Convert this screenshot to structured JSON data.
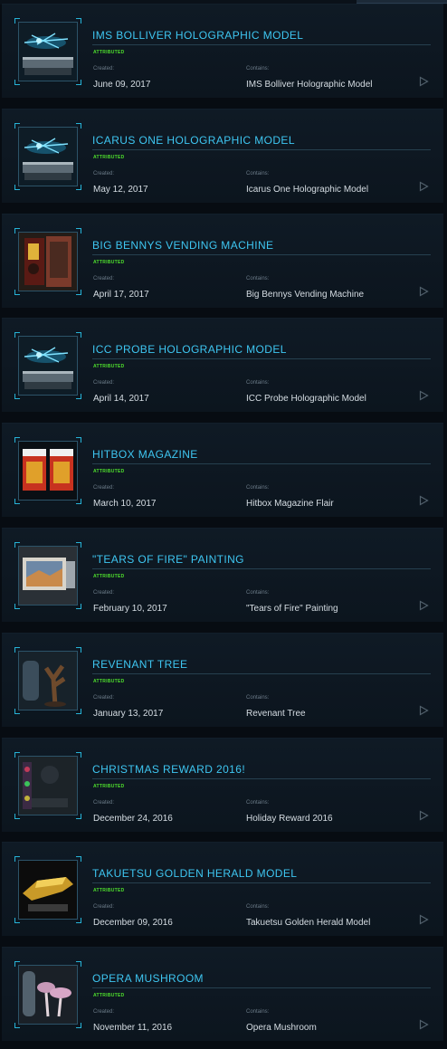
{
  "labels": {
    "created": "Created:",
    "contains": "Contains:"
  },
  "items": [
    {
      "title": "IMS BOLLIVER HOLOGRAPHIC MODEL",
      "tag": "ATTRIBUTED",
      "created": "June 09, 2017",
      "contains": "IMS Bolliver Holographic Model",
      "icon": "holographic-model-icon"
    },
    {
      "title": "ICARUS ONE HOLOGRAPHIC MODEL",
      "tag": "ATTRIBUTED",
      "created": "May 12, 2017",
      "contains": "Icarus One Holographic Model",
      "icon": "holographic-model-icon"
    },
    {
      "title": "BIG BENNYS VENDING MACHINE",
      "tag": "ATTRIBUTED",
      "created": "April 17, 2017",
      "contains": "Big Bennys Vending Machine",
      "icon": "vending-machine-icon"
    },
    {
      "title": "ICC PROBE HOLOGRAPHIC MODEL",
      "tag": "ATTRIBUTED",
      "created": "April 14, 2017",
      "contains": "ICC Probe Holographic Model",
      "icon": "holographic-model-icon"
    },
    {
      "title": "HITBOX MAGAZINE",
      "tag": "ATTRIBUTED",
      "created": "March 10, 2017",
      "contains": "Hitbox Magazine Flair",
      "icon": "magazine-icon"
    },
    {
      "title": "\"TEARS OF FIRE\" PAINTING",
      "tag": "ATTRIBUTED",
      "created": "February 10, 2017",
      "contains": "\"Tears of Fire\" Painting",
      "icon": "painting-icon"
    },
    {
      "title": "REVENANT TREE",
      "tag": "ATTRIBUTED",
      "created": "January 13, 2017",
      "contains": "Revenant Tree",
      "icon": "revenant-tree-icon"
    },
    {
      "title": "CHRISTMAS REWARD 2016!",
      "tag": "ATTRIBUTED",
      "created": "December 24, 2016",
      "contains": "Holiday Reward 2016",
      "icon": "christmas-reward-icon"
    },
    {
      "title": "TAKUETSU GOLDEN HERALD MODEL",
      "tag": "ATTRIBUTED",
      "created": "December 09, 2016",
      "contains": "Takuetsu Golden Herald Model",
      "icon": "golden-ship-model-icon"
    },
    {
      "title": "OPERA MUSHROOM",
      "tag": "ATTRIBUTED",
      "created": "November 11, 2016",
      "contains": "Opera Mushroom",
      "icon": "mushroom-icon"
    }
  ]
}
